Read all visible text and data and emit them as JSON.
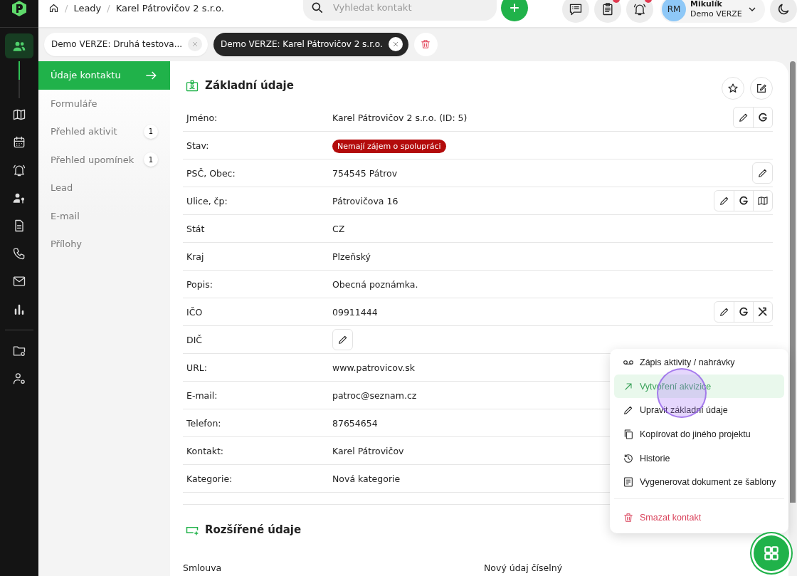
{
  "rail": {
    "items": [
      {
        "kind": "people",
        "selected": true
      },
      {
        "kind": "map",
        "selected": false
      },
      {
        "kind": "calendar",
        "selected": false
      },
      {
        "kind": "bell",
        "selected": false
      },
      {
        "kind": "userkey",
        "selected": false
      },
      {
        "kind": "doc",
        "selected": false
      },
      {
        "kind": "phone",
        "selected": false
      },
      {
        "kind": "mail",
        "selected": false
      },
      {
        "kind": "chart",
        "selected": false
      }
    ],
    "bottom_items": [
      {
        "kind": "foldergear",
        "selected": false
      },
      {
        "kind": "usergear",
        "selected": false
      }
    ]
  },
  "header": {
    "separator": "/",
    "breadcrumb": [
      "Leady",
      "Karel Pátrovičov 2 s.r.o."
    ],
    "search": {
      "placeholder": "Vyhledat kontakt"
    },
    "tools": [
      {
        "kind": "chat"
      },
      {
        "kind": "clipboard",
        "badge": true
      },
      {
        "kind": "bell",
        "badge": true
      }
    ],
    "user": {
      "initials": "RM",
      "name": "Mikulík",
      "role": "Demo VERZE"
    }
  },
  "tabs": [
    {
      "label": "Demo VERZE: Druhá testova...",
      "selected": false
    },
    {
      "label": "Demo VERZE: Karel Pátrovičov 2 s.r.o.",
      "selected": true
    }
  ],
  "subnav": [
    {
      "label": "Údaje kontaktu",
      "selected": true
    },
    {
      "label": "Formuláře",
      "selected": false
    },
    {
      "label": "Přehled aktivit",
      "selected": false,
      "count": "1"
    },
    {
      "label": "Přehled upomínek",
      "selected": false,
      "count": "1"
    },
    {
      "label": "Lead",
      "selected": false
    },
    {
      "label": "E-mail",
      "selected": false
    },
    {
      "label": "Přílohy",
      "selected": false
    }
  ],
  "basic": {
    "title": "Základní údaje",
    "fields": [
      {
        "label": "Jméno:",
        "kind": "text",
        "value": "Karel Pátrovičov 2 s.r.o. (ID: 5)",
        "actions": [
          {
            "kind": "edit"
          },
          {
            "kind": "google"
          }
        ]
      },
      {
        "label": "Stav:",
        "kind": "status",
        "value": "Nemají zájem o spolupráci"
      },
      {
        "label": "PSČ, Obec:",
        "kind": "text",
        "value": "754545 Pátrov",
        "actions": [
          {
            "kind": "edit"
          }
        ]
      },
      {
        "label": "Ulice, čp:",
        "kind": "text",
        "value": "Pátrovičova 16",
        "actions": [
          {
            "kind": "edit"
          },
          {
            "kind": "google"
          },
          {
            "kind": "map"
          }
        ]
      },
      {
        "label": "Stát",
        "kind": "text",
        "value": "CZ"
      },
      {
        "label": "Kraj",
        "kind": "text",
        "value": "Plzeňský"
      },
      {
        "label": "Popis:",
        "kind": "text",
        "value": "Obecná poznámka."
      },
      {
        "label": "IČO",
        "kind": "text",
        "value": "09911444",
        "actions": [
          {
            "kind": "edit"
          },
          {
            "kind": "google"
          },
          {
            "kind": "register"
          }
        ]
      },
      {
        "label": "DIČ",
        "kind": "empty",
        "actions": [
          {
            "kind": "edit"
          }
        ]
      },
      {
        "label": "URL:",
        "kind": "text",
        "value": "www.patrovicov.sk"
      },
      {
        "label": "E-mail:",
        "kind": "text",
        "value": "patroc@seznam.cz"
      },
      {
        "label": "Telefon:",
        "kind": "text",
        "value": "87654654"
      },
      {
        "label": "Kontakt:",
        "kind": "text",
        "value": "Karel Pátrovičov"
      },
      {
        "label": "Kategorie:",
        "kind": "text",
        "value": "Nová kategorie"
      }
    ]
  },
  "extended": {
    "title": "Rozšířené údaje",
    "columns": [
      "Smlouva",
      "Nový údaj číselný"
    ]
  },
  "menu": [
    {
      "label": "Zápis aktivity / nahrávky",
      "kind": "voicemail",
      "selected": false,
      "danger": false
    },
    {
      "label": "Vytvoření akvizice",
      "kind": "arrow",
      "selected": true,
      "danger": false
    },
    {
      "label": "Upravit základní údaje",
      "kind": "pencil",
      "selected": false,
      "danger": false
    },
    {
      "label": "Kopírovat do jiného projektu",
      "kind": "copy",
      "selected": false,
      "danger": false
    },
    {
      "label": "Historie",
      "kind": "history",
      "selected": false,
      "danger": false
    },
    {
      "label": "Vygenerovat dokument ze šablony",
      "kind": "template",
      "selected": false,
      "danger": false
    },
    {
      "label": "Smazat kontakt",
      "kind": "trash",
      "selected": false,
      "danger": true
    }
  ],
  "touch_indicator": true
}
